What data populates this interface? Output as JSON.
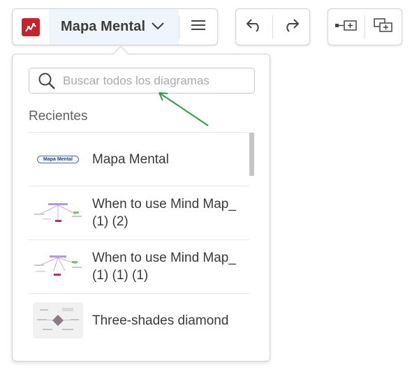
{
  "toolbar": {
    "doc_title": "Mapa Mental",
    "icons": {
      "logo": "lucidchart-logo-icon",
      "dropdown": "chevron-down-icon",
      "menu": "hamburger-menu-icon",
      "undo": "undo-icon",
      "redo": "redo-icon",
      "insert_a": "insert-shape-icon",
      "insert_b": "insert-container-icon"
    }
  },
  "panel": {
    "search_placeholder": "Buscar todos los diagramas",
    "section_label": "Recientes",
    "items": [
      {
        "label": "Mapa Mental",
        "thumb_text": "Mapa Mental"
      },
      {
        "label": "When to use Mind Map_ (1) (2)"
      },
      {
        "label": "When to use Mind Map_ (1) (1) (1)"
      },
      {
        "label": "Three-shades diamond"
      }
    ]
  },
  "colors": {
    "brand": "#c8232c",
    "switch_bg": "#eef6fb",
    "annotation_arrow": "#2e9a44"
  }
}
